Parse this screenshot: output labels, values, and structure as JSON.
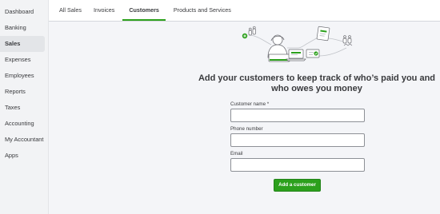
{
  "sidebar": {
    "items": [
      {
        "label": "Dashboard"
      },
      {
        "label": "Banking"
      },
      {
        "label": "Sales"
      },
      {
        "label": "Expenses"
      },
      {
        "label": "Employees"
      },
      {
        "label": "Reports"
      },
      {
        "label": "Taxes"
      },
      {
        "label": "Accounting"
      },
      {
        "label": "My Accountant"
      },
      {
        "label": "Apps"
      }
    ],
    "active": "Sales"
  },
  "tabs": [
    {
      "label": "All Sales"
    },
    {
      "label": "Invoices"
    },
    {
      "label": "Customers"
    },
    {
      "label": "Products and Services"
    }
  ],
  "active_tab": "Customers",
  "empty_state": {
    "illustration": "customers-network-illustration",
    "headline": "Add your customers to keep track of who’s paid you and who owes you money"
  },
  "form": {
    "customer_name_label": "Customer name *",
    "customer_name_value": "",
    "phone_label": "Phone number",
    "phone_value": "",
    "email_label": "Email",
    "email_value": ""
  },
  "add_button_label": "Add a customer",
  "colors": {
    "accent": "#2ca01c",
    "sidebar_bg": "#f2f3f5",
    "content_bg": "#f4f5f8",
    "text": "#393a3d"
  }
}
